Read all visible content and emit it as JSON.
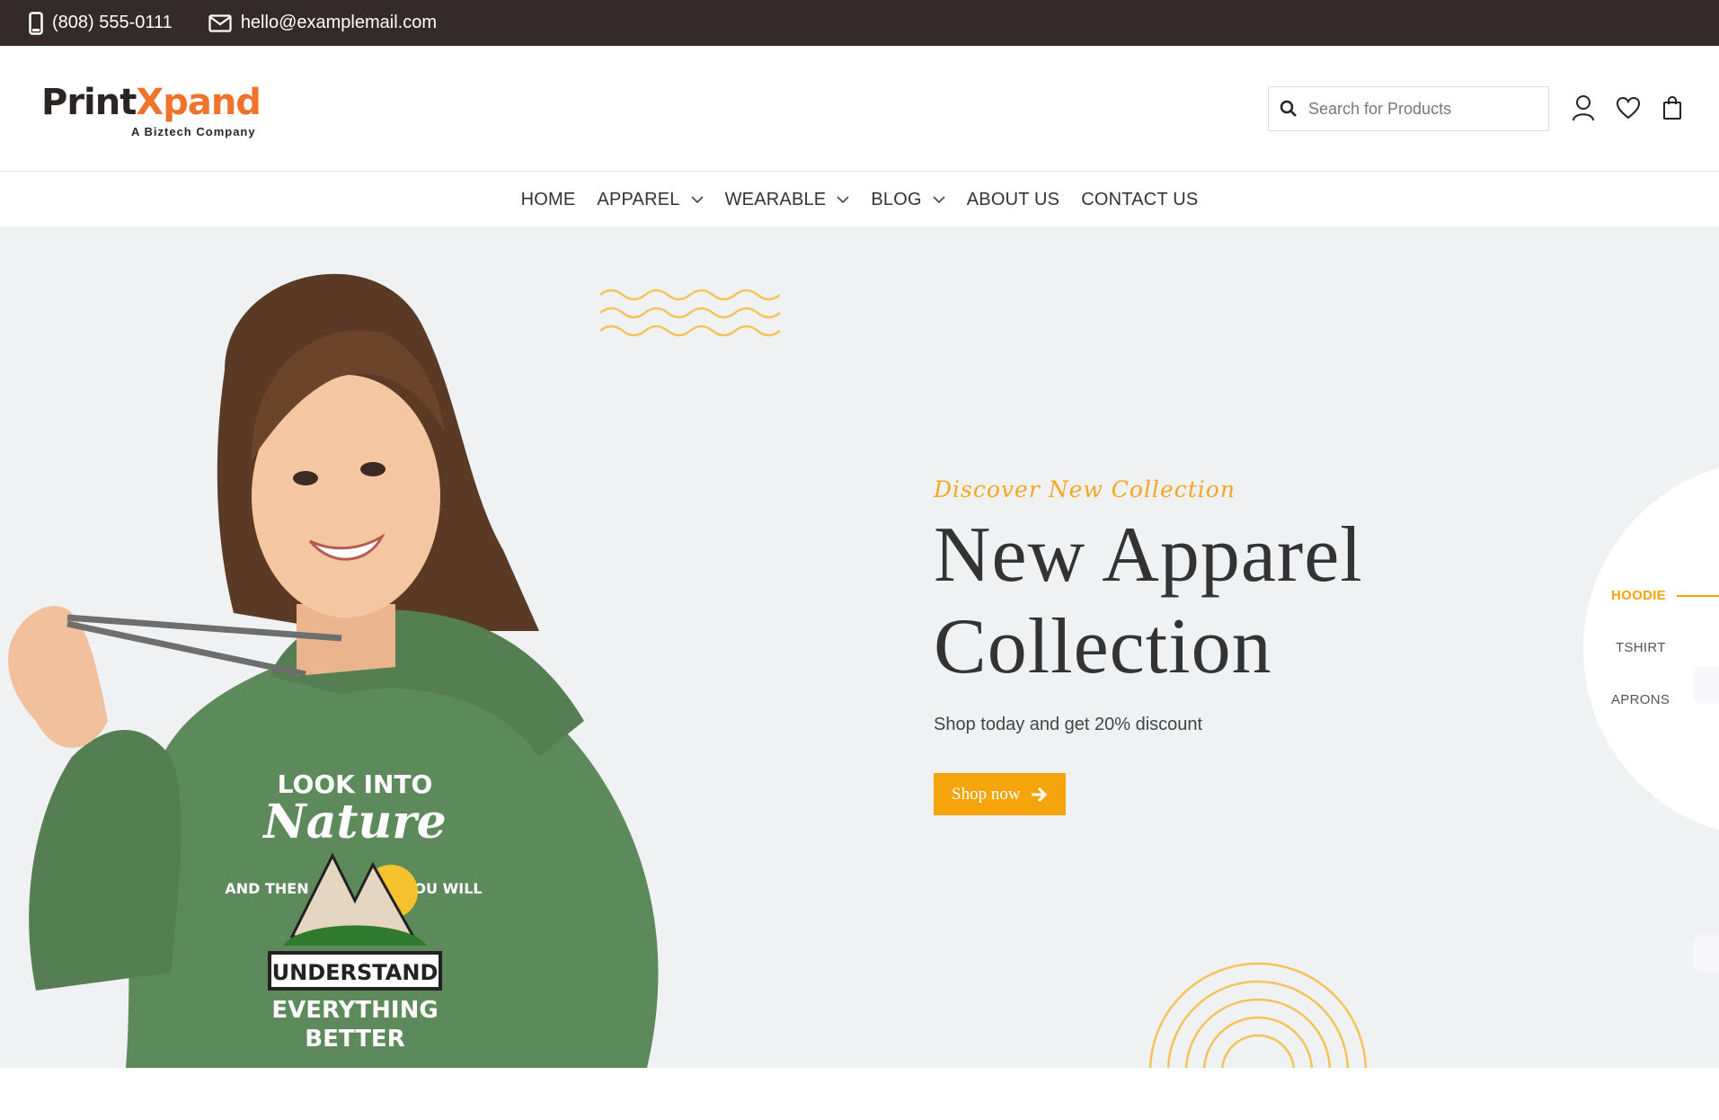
{
  "topbar": {
    "phone": "(808) 555-0111",
    "email": "hello@examplemail.com",
    "phone_icon": "phone-icon",
    "email_icon": "mail-icon"
  },
  "header": {
    "logo_part1": "Print",
    "logo_part2": "Xpand",
    "logo_tagline": "A Biztech Company",
    "search_placeholder": "Search for Products",
    "icons": [
      "user-icon",
      "heart-icon",
      "shopping-bag-icon"
    ]
  },
  "nav": {
    "items": [
      {
        "label": "HOME",
        "dropdown": false
      },
      {
        "label": "APPAREL",
        "dropdown": true
      },
      {
        "label": "WEARABLE",
        "dropdown": true
      },
      {
        "label": "BLOG",
        "dropdown": true
      },
      {
        "label": "ABOUT US",
        "dropdown": false
      },
      {
        "label": "CONTACT US",
        "dropdown": false
      }
    ]
  },
  "hero": {
    "kicker": "Discover New Collection",
    "headline_line1": "New Apparel",
    "headline_line2": "Collection",
    "subtitle": "Shop today and get 20% discount",
    "cta_label": "Shop now",
    "shirt_print": {
      "line1": "LOOK INTO",
      "line2": "Nature",
      "left": "AND THEN",
      "right": "YOU WILL",
      "banner": "UNDERSTAND",
      "line3": "EVERYTHING",
      "line4": "BETTER"
    }
  },
  "categories": {
    "items": [
      {
        "label": "HOODIE",
        "active": true
      },
      {
        "label": "TSHIRT",
        "active": false
      },
      {
        "label": "APRONS",
        "active": false
      }
    ]
  },
  "colors": {
    "accent": "#f5a50b",
    "logo_orange": "#f0732c",
    "topbar_bg": "#332a29",
    "hero_bg": "#f0f1f2",
    "hoodie_green": "#5d8a5a"
  }
}
